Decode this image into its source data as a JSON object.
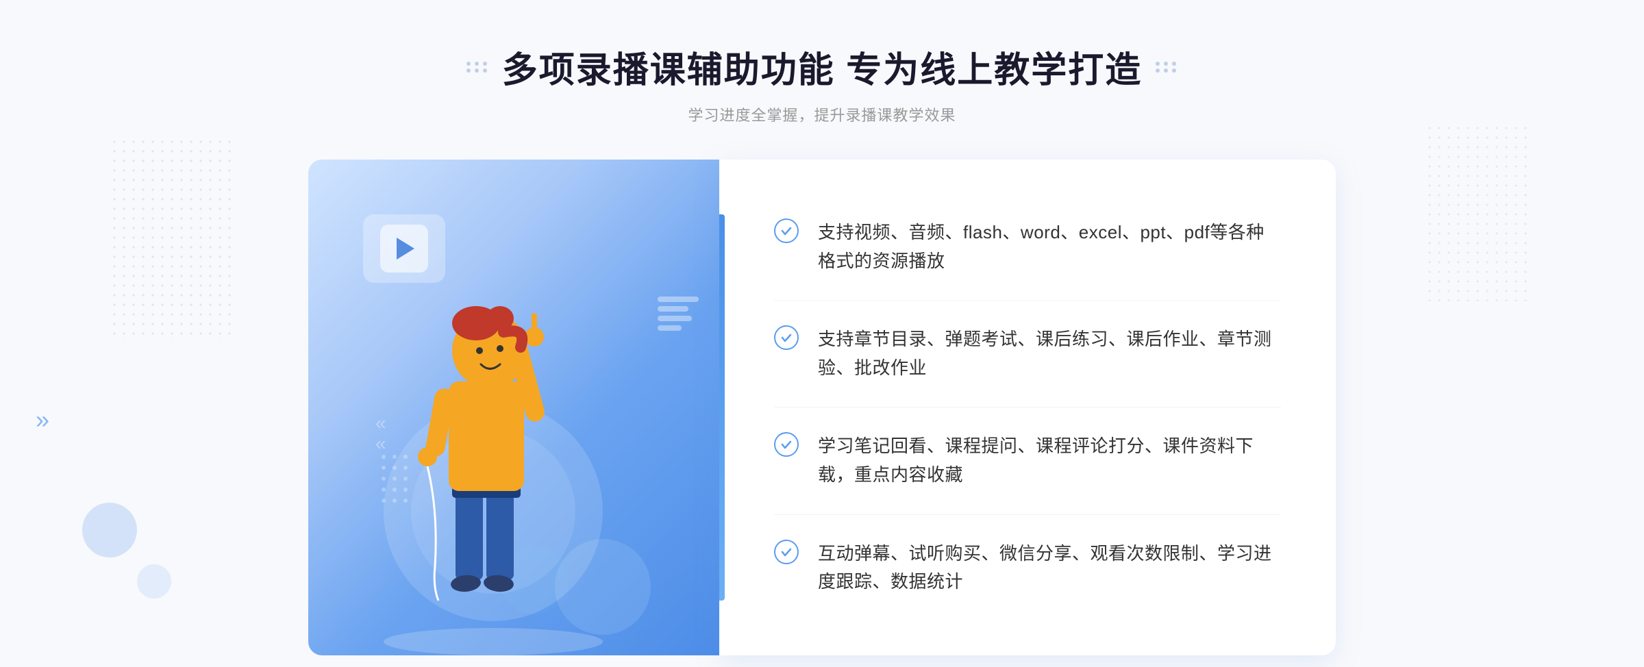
{
  "header": {
    "title": "多项录播课辅助功能 专为线上教学打造",
    "subtitle": "学习进度全掌握，提升录播课教学效果",
    "dot_decorator_count": 6
  },
  "features": [
    {
      "id": 1,
      "text": "支持视频、音频、flash、word、excel、ppt、pdf等各种格式的资源播放"
    },
    {
      "id": 2,
      "text": "支持章节目录、弹题考试、课后练习、课后作业、章节测验、批改作业"
    },
    {
      "id": 3,
      "text": "学习笔记回看、课程提问、课程评论打分、课件资料下载，重点内容收藏"
    },
    {
      "id": 4,
      "text": "互动弹幕、试听购买、微信分享、观看次数限制、学习进度跟踪、数据统计"
    }
  ],
  "colors": {
    "primary_blue": "#4d8de8",
    "light_blue": "#a8c8f8",
    "check_blue": "#5b9cf0",
    "text_dark": "#333333",
    "text_gray": "#999999",
    "bg_light": "#f8f9fc"
  },
  "decorators": {
    "arrows_left": "»",
    "dot_groups": true
  }
}
